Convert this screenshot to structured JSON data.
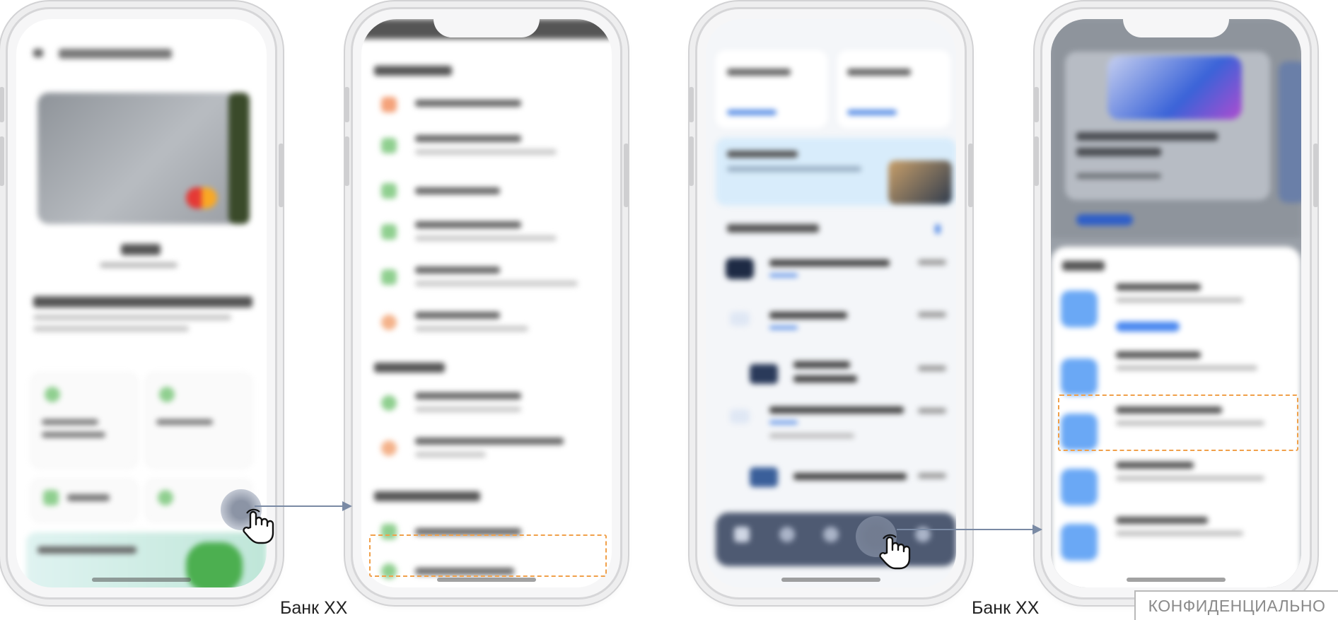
{
  "captions": {
    "left": "Банк ХХ",
    "right": "Банк ХХ"
  },
  "badge": "КОНФИДЕНЦИАЛЬНО",
  "colors": {
    "highlight": "#f0a04a",
    "arrow": "#7a8aa4",
    "card_accent": "#4a88f0"
  }
}
